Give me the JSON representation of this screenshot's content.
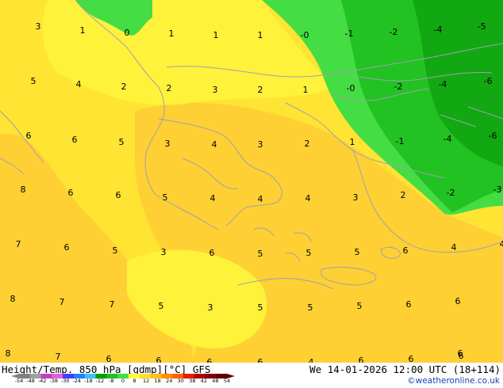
{
  "map": {
    "field_colors": {
      "yellow_light": "#fff23a",
      "yellow": "#ffe433",
      "yellow_orange": "#ffd033",
      "green_light": "#44dd44",
      "green": "#22c222",
      "green_dark": "#12a812",
      "coast": "#a0a0b0"
    },
    "values": [
      "3",
      "1",
      "0",
      "1",
      "1",
      "1",
      "-0",
      "-1",
      "-2",
      "-4",
      "-5",
      "5",
      "4",
      "2",
      "2",
      "3",
      "2",
      "1",
      "-0",
      "-2",
      "-4",
      "-6",
      "6",
      "6",
      "5",
      "3",
      "4",
      "3",
      "2",
      "1",
      "-1",
      "-4",
      "-6",
      "8",
      "6",
      "6",
      "5",
      "4",
      "4",
      "4",
      "3",
      "2",
      "-2",
      "-3",
      "7",
      "6",
      "5",
      "3",
      "6",
      "5",
      "5",
      "5",
      "6",
      "4",
      "4",
      "8",
      "7",
      "7",
      "5",
      "3",
      "5",
      "5",
      "5",
      "6",
      "6",
      "8",
      "7",
      "6",
      "6",
      "6",
      "6",
      "4",
      "6",
      "6",
      "6",
      "5",
      "6"
    ]
  },
  "footer": {
    "title": "Height/Temp. 850 hPa [gdmp][°C] GFS",
    "datetime": "We 14-01-2026 12:00 UTC (18+114)",
    "credit": "©weatheronline.co.uk"
  },
  "legend": {
    "ticks": [
      "-54",
      "-48",
      "-42",
      "-38",
      "-30",
      "-24",
      "-18",
      "-12",
      "-8",
      "0",
      "8",
      "12",
      "18",
      "24",
      "30",
      "38",
      "42",
      "48",
      "54"
    ],
    "colors": [
      "#808080",
      "#a0a0a0",
      "#c040c0",
      "#e060e0",
      "#4040ff",
      "#2080ff",
      "#40c0ff",
      "#00a000",
      "#20c020",
      "#40e040",
      "#ffff40",
      "#ffe030",
      "#ffc020",
      "#ff9000",
      "#ff6000",
      "#e02000",
      "#b00000",
      "#800000",
      "#600000"
    ]
  }
}
